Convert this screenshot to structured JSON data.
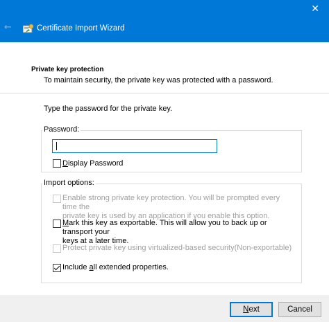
{
  "window": {
    "title": "Certificate Import Wizard",
    "close_glyph": "✕",
    "back_glyph": "←",
    "colors": {
      "titlebar": "#0078d7",
      "accent": "#0078d7"
    }
  },
  "header": {
    "section_title": "Private key protection",
    "section_desc": "To maintain security, the private key was protected with a password."
  },
  "content": {
    "prompt": "Type the password for the private key.",
    "password_group": {
      "legend": "Password:",
      "value": "",
      "display_password": {
        "pre": "",
        "accel": "D",
        "post": "isplay Password",
        "checked": false
      }
    },
    "import_options": {
      "legend": "Import options:",
      "strong_protection": {
        "line1": "Enable strong private key protection. You will be prompted every time the",
        "line2": "private key is used by an application if you enable this option.",
        "checked": false,
        "disabled": true
      },
      "exportable": {
        "pre": "",
        "accel": "M",
        "line1_post": "ark this key as exportable. This will allow you to back up or transport your",
        "line2": "keys at a later time.",
        "checked": false,
        "disabled": false
      },
      "vbs_protection": {
        "label": "Protect private key using virtualized-based security(Non-exportable)",
        "checked": false,
        "disabled": true
      },
      "extended_properties": {
        "pre": "Include ",
        "accel": "a",
        "post": "ll extended properties.",
        "checked": true,
        "disabled": false
      }
    }
  },
  "footer": {
    "next": {
      "accel": "N",
      "post": "ext"
    },
    "cancel": "Cancel"
  }
}
